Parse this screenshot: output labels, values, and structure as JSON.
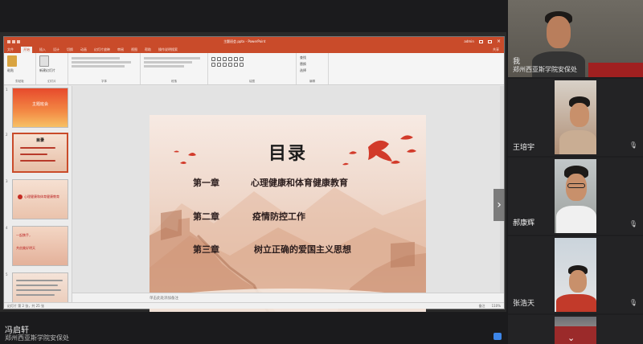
{
  "ppt": {
    "window_title": "主题班会.pptx  -  PowerPoint",
    "user": "admin",
    "tabs": [
      "文件",
      "开始",
      "插入",
      "设计",
      "切换",
      "动画",
      "幻灯片放映",
      "审阅",
      "视图",
      "帮助",
      "操作说明搜索"
    ],
    "share": "共享",
    "ribbon_groups": [
      "剪贴板",
      "幻灯片",
      "字体",
      "段落",
      "绘图",
      "编辑"
    ],
    "paste_label": "粘贴",
    "new_slide_label": "新建幻灯片",
    "find_label": "查找",
    "replace_label": "替换",
    "select_label": "选择",
    "notes_placeholder": "单击此处添加备注",
    "status_left": "幻灯片 第 2 张，共 25 张",
    "status_notes": "备注",
    "status_zoom": "110%",
    "thumb_numbers": [
      "1",
      "2",
      "3",
      "4",
      "5"
    ],
    "thumb1_title": "主题班会",
    "thumb2_title": "目录",
    "thumb3_text": "心理健康和体育健康教育",
    "thumb4_line1": "一起携手，",
    "thumb4_line2": "共创美好明天"
  },
  "slide": {
    "title": "目录",
    "chapters": [
      {
        "label": "第一章",
        "text": "心理健康和体育健康教育"
      },
      {
        "label": "第二章",
        "text": "疫情防控工作"
      },
      {
        "label": "第三章",
        "text": "树立正确的爱国主义思想"
      }
    ]
  },
  "participants": [
    {
      "name": "我",
      "org": "郑州西亚斯学院安保处"
    },
    {
      "name": "王培宇"
    },
    {
      "name": "郝康辉"
    },
    {
      "name": "张浩天"
    }
  ],
  "speaker": {
    "name": "冯启轩",
    "org": "郑州西亚斯学院安保处"
  },
  "colors": {
    "accent": "#c94b2a",
    "slide_red": "#d23a2a"
  }
}
